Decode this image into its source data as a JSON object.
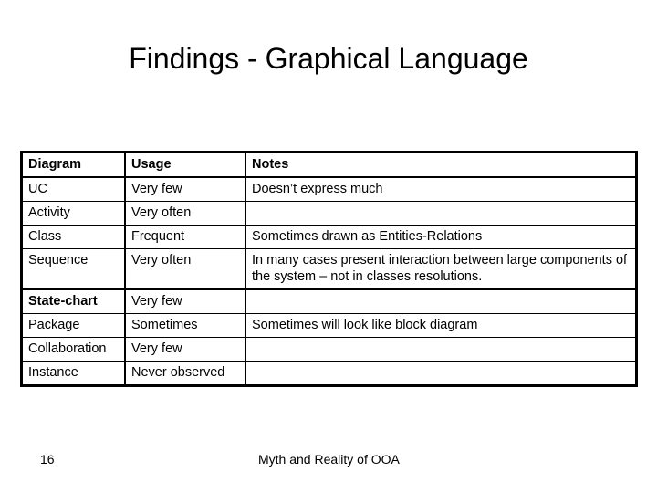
{
  "slide": {
    "title": "Findings  - Graphical Language",
    "table": {
      "headers": [
        "Diagram",
        "Usage",
        "Notes"
      ],
      "rows": [
        {
          "diagram": "UC",
          "usage": "Very few",
          "notes": "Doesn’t express much"
        },
        {
          "diagram": "Activity",
          "usage": "Very often",
          "notes": ""
        },
        {
          "diagram": "Class",
          "usage": "Frequent",
          "notes": "Sometimes drawn as Entities-Relations"
        },
        {
          "diagram": "Sequence",
          "usage": "Very often",
          "notes": "In many cases present interaction between large components of the system – not in classes resolutions."
        },
        {
          "diagram": "State-chart",
          "usage": "Very few",
          "notes": ""
        },
        {
          "diagram": "Package",
          "usage": "Sometimes",
          "notes": "Sometimes will look like block diagram"
        },
        {
          "diagram": "Collaboration",
          "usage": "Very few",
          "notes": ""
        },
        {
          "diagram": "Instance",
          "usage": "Never observed",
          "notes": ""
        }
      ]
    },
    "footer": {
      "page_number": "16",
      "text": "Myth and Reality of OOA"
    }
  }
}
